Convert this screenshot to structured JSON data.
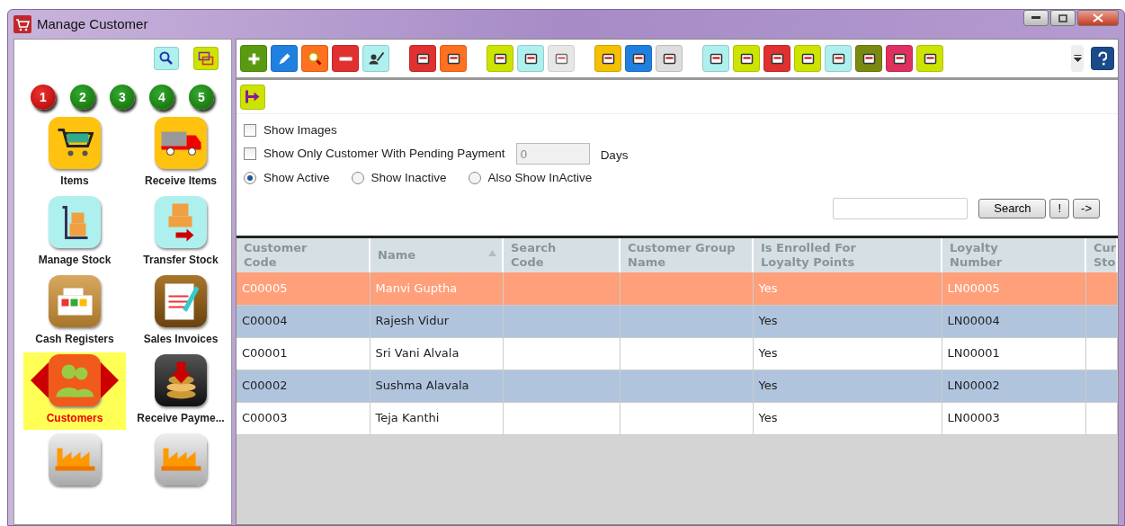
{
  "window": {
    "title": "Manage Customer"
  },
  "sidebar": {
    "pages": [
      {
        "label": "1",
        "selected": true
      },
      {
        "label": "2",
        "selected": false
      },
      {
        "label": "3",
        "selected": false
      },
      {
        "label": "4",
        "selected": false
      },
      {
        "label": "5",
        "selected": false
      }
    ],
    "modules": [
      {
        "label": "Items",
        "selected": false
      },
      {
        "label": "Receive Items",
        "selected": false
      },
      {
        "label": "Manage Stock",
        "selected": false
      },
      {
        "label": "Transfer Stock",
        "selected": false
      },
      {
        "label": "Cash Registers",
        "selected": false
      },
      {
        "label": "Sales Invoices",
        "selected": false
      },
      {
        "label": "Customers",
        "selected": true
      },
      {
        "label": "Receive Payme...",
        "selected": false
      },
      {
        "selected": false
      },
      {
        "selected": false
      }
    ]
  },
  "toolbar": {
    "groups": [
      [
        {
          "disabled": false
        },
        {
          "disabled": false
        },
        {
          "disabled": false
        },
        {
          "disabled": false
        },
        {
          "disabled": false
        }
      ],
      [
        {
          "disabled": false
        },
        {
          "disabled": false
        }
      ],
      [
        {
          "disabled": false
        },
        {
          "disabled": false
        },
        {
          "disabled": true
        }
      ],
      [
        {
          "disabled": false
        },
        {
          "disabled": false
        },
        {
          "disabled": false
        }
      ],
      [
        {
          "disabled": false
        },
        {
          "disabled": false
        },
        {
          "disabled": false
        },
        {
          "disabled": false
        },
        {
          "disabled": false
        },
        {
          "disabled": false
        },
        {
          "disabled": false
        },
        {
          "disabled": false
        }
      ]
    ]
  },
  "filters": {
    "checkboxes": [
      {
        "label": "Show Images",
        "checked": false
      },
      {
        "label": "Show Only Customer With Pending Payment",
        "checked": false
      }
    ],
    "days": {
      "value": "0",
      "unit": "Days"
    },
    "radios": [
      {
        "label": "Show Active",
        "selected": true
      },
      {
        "label": "Show Inactive",
        "selected": false
      },
      {
        "label": "Also Show InActive",
        "selected": false
      }
    ]
  },
  "search": {
    "buttons": [
      "Search",
      "!",
      "->"
    ]
  },
  "table": {
    "columns": [
      {
        "label": "Customer Code",
        "sorted": false
      },
      {
        "label": "Name",
        "sorted": true
      },
      {
        "label": "Search Code",
        "sorted": false
      },
      {
        "label": "Customer Group Name",
        "sorted": false
      },
      {
        "label": "Is Enrolled For Loyalty Points",
        "sorted": false
      },
      {
        "label": "Loyalty Number",
        "sorted": false
      },
      {
        "label": "Cur Sto",
        "sorted": false
      }
    ],
    "rows": [
      {
        "selected": true,
        "cells": [
          "C00005",
          "Manvi Guptha",
          "",
          "",
          "Yes",
          "LN00005",
          ""
        ]
      },
      {
        "selected": false,
        "cells": [
          "C00004",
          "Rajesh Vidur",
          "",
          "",
          "Yes",
          "LN00004",
          ""
        ]
      },
      {
        "selected": false,
        "cells": [
          "C00001",
          "Sri Vani Alvala",
          "",
          "",
          "Yes",
          "LN00001",
          ""
        ]
      },
      {
        "selected": false,
        "cells": [
          "C00002",
          "Sushma Alavala",
          "",
          "",
          "Yes",
          "LN00002",
          ""
        ]
      },
      {
        "selected": false,
        "cells": [
          "C00003",
          "Teja Kanthi",
          "",
          "",
          "Yes",
          "LN00003",
          ""
        ]
      }
    ]
  }
}
